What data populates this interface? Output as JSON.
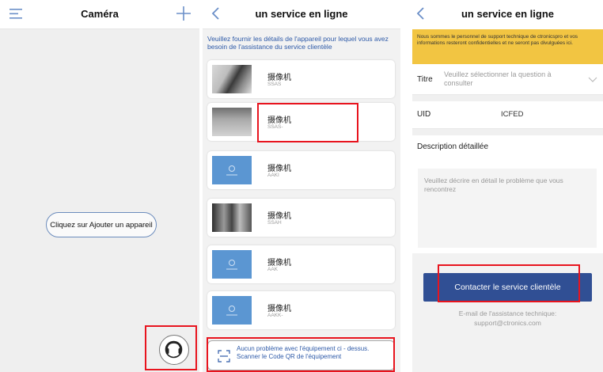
{
  "left_screen": {
    "title": "Caméra",
    "add_device_label": "Cliquez sur Ajouter un appareil"
  },
  "middle_screen": {
    "title": "un service en ligne",
    "intro": "Veuillez fournir les détails de l'appareil pour lequel vous avez besoin de l'assistance du service clientèle",
    "devices": [
      {
        "name": "摄像机",
        "uid": "SSAS"
      },
      {
        "name": "摄像机",
        "uid": "SSAS-"
      },
      {
        "name": "摄像机",
        "uid": "AAKI"
      },
      {
        "name": "摄像机",
        "uid": "SSAH"
      },
      {
        "name": "摄像机",
        "uid": "AAK"
      },
      {
        "name": "摄像机",
        "uid": "AAKK-"
      }
    ],
    "scan_text": "Aucun problème avec l'équipement ci - dessus. Scanner le Code QR de l'équipement"
  },
  "right_screen": {
    "title": "un service en ligne",
    "notice": "Nous sommes le personnel de support technique de ctronicspro et vos informations resteront confidentielles et ne seront pas divulguées ici.",
    "title_label": "Titre",
    "title_placeholder": "Veuillez sélectionner la question à consulter",
    "uid_label": "UID",
    "uid_value": "ICFED",
    "description_label": "Description détaillée",
    "description_placeholder": "Veuillez décrire en détail le problème que vous rencontrez",
    "contact_button": "Contacter le service clientèle",
    "email_line1": "E-mail de l'assistance technique:",
    "email_line2": "support@ctronics.com"
  },
  "colors": {
    "accent": "#304f94",
    "link_text": "#2e5aa8",
    "notice_bg": "#f2c542",
    "highlight": "#e8141e",
    "thumb_blue": "#5b96d2"
  }
}
